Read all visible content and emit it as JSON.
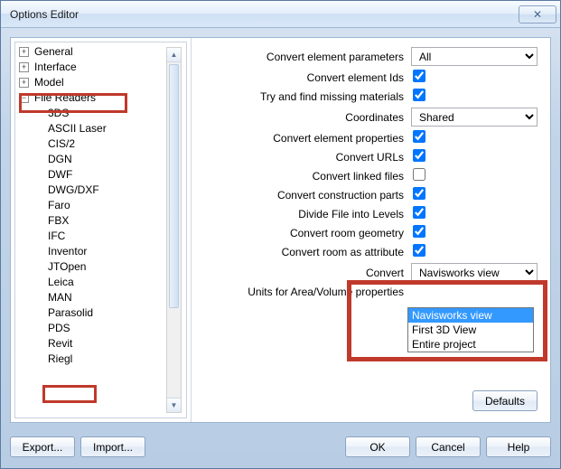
{
  "window": {
    "title": "Options Editor"
  },
  "tree": {
    "top": [
      {
        "label": "General",
        "exp": "+"
      },
      {
        "label": "Interface",
        "exp": "+"
      },
      {
        "label": "Model",
        "exp": "+"
      },
      {
        "label": "File Readers",
        "exp": "−"
      }
    ],
    "readers": [
      "3DS",
      "ASCII Laser",
      "CIS/2",
      "DGN",
      "DWF",
      "DWG/DXF",
      "Faro",
      "FBX",
      "IFC",
      "Inventor",
      "JTOpen",
      "Leica",
      "MAN",
      "Parasolid",
      "PDS",
      "Revit",
      "Riegl"
    ]
  },
  "opts": {
    "convert_params_lbl": "Convert element parameters",
    "convert_params_val": "All",
    "convert_ids_lbl": "Convert element Ids",
    "missing_mats_lbl": "Try and find missing materials",
    "coords_lbl": "Coordinates",
    "coords_val": "Shared",
    "convert_props_lbl": "Convert element properties",
    "convert_urls_lbl": "Convert URLs",
    "convert_linked_lbl": "Convert linked files",
    "convert_constr_lbl": "Convert construction parts",
    "divide_levels_lbl": "Divide File into Levels",
    "convert_room_geom_lbl": "Convert room geometry",
    "convert_room_attr_lbl": "Convert room as attribute",
    "convert_lbl": "Convert",
    "convert_val": "Navisworks view",
    "convert_options": [
      "Navisworks view",
      "First 3D View",
      "Entire project"
    ],
    "units_lbl": "Units for Area/Volume properties"
  },
  "buttons": {
    "defaults": "Defaults",
    "export": "Export...",
    "import": "Import...",
    "ok": "OK",
    "cancel": "Cancel",
    "help": "Help"
  }
}
